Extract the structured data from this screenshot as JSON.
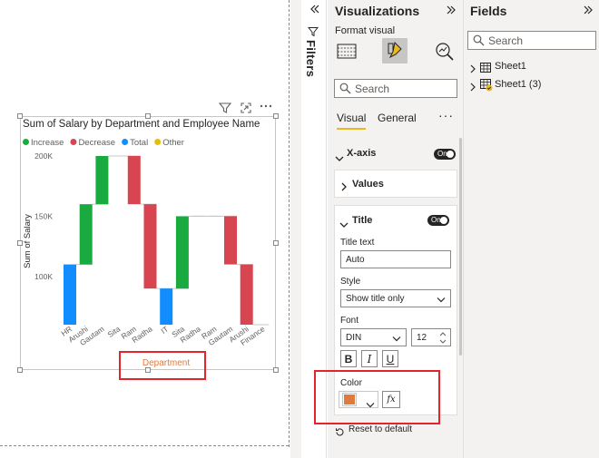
{
  "filters": {
    "title": "Filters",
    "collapse_icon": "double-chevron-left"
  },
  "visualizations": {
    "title": "Visualizations",
    "subtitle": "Format visual",
    "search_placeholder": "Search",
    "tabs": [
      {
        "label": "Visual",
        "active": true
      },
      {
        "label": "General",
        "active": false
      }
    ],
    "more_label": "···",
    "sections": {
      "x_axis": {
        "label": "X-axis",
        "toggle": "On"
      },
      "values": {
        "label": "Values"
      },
      "title": {
        "label": "Title",
        "toggle": "On",
        "title_text_label": "Title text",
        "title_text_value": "Auto",
        "style_label": "Style",
        "style_value": "Show title only",
        "font_label": "Font",
        "font_family_value": "DIN",
        "font_size_value": "12",
        "bold_label": "B",
        "italic_label": "I",
        "underline_label": "U",
        "color_label": "Color",
        "color_value": "#e07a3d",
        "fx_label": "fx"
      }
    },
    "reset_label": "Reset to default"
  },
  "fields": {
    "title": "Fields",
    "search_placeholder": "Search",
    "tables": [
      {
        "name": "Sheet1"
      },
      {
        "name": "Sheet1 (3)"
      }
    ]
  },
  "visual": {
    "title": "Sum of Salary by Department and Employee Name",
    "legend": [
      {
        "label": "Increase",
        "color": "#1aab40"
      },
      {
        "label": "Decrease",
        "color": "#d64550"
      },
      {
        "label": "Total",
        "color": "#118dff"
      },
      {
        "label": "Other",
        "color": "#e6c000"
      }
    ],
    "y_axis_label": "Sum of Salary",
    "x_axis_title": "Department",
    "x_axis_title_color": "#e07a3d"
  },
  "chart_data": {
    "type": "bar",
    "subtype": "waterfall",
    "title": "Sum of Salary by Department and Employee Name",
    "xlabel": "Department",
    "ylabel": "Sum of Salary",
    "y_ticks": [
      "100K",
      "150K",
      "200K"
    ],
    "y_tick_values": [
      100000,
      150000,
      200000
    ],
    "ylim": [
      60000,
      200000
    ],
    "grid": false,
    "legend_position": "top-left",
    "categories": [
      "HR",
      "Arushi",
      "Gautam",
      "Sita",
      "Ram",
      "Radha",
      "IT",
      "Sita",
      "Radha",
      "Ram",
      "Gautam",
      "Arushi",
      "Finance"
    ],
    "bars": [
      {
        "category": "HR",
        "kind": "Total",
        "start": 60000,
        "end": 110000
      },
      {
        "category": "Arushi",
        "kind": "Increase",
        "start": 110000,
        "end": 160000
      },
      {
        "category": "Gautam",
        "kind": "Increase",
        "start": 160000,
        "end": 200000
      },
      {
        "category": "Sita",
        "kind": "Other",
        "start": 200000,
        "end": 200000
      },
      {
        "category": "Ram",
        "kind": "Decrease",
        "start": 200000,
        "end": 160000
      },
      {
        "category": "Radha",
        "kind": "Decrease",
        "start": 160000,
        "end": 90000
      },
      {
        "category": "IT",
        "kind": "Total",
        "start": 60000,
        "end": 90000
      },
      {
        "category": "Sita",
        "kind": "Increase",
        "start": 90000,
        "end": 150000
      },
      {
        "category": "Radha",
        "kind": "Other",
        "start": 150000,
        "end": 150000
      },
      {
        "category": "Ram",
        "kind": "Other",
        "start": 150000,
        "end": 150000
      },
      {
        "category": "Gautam",
        "kind": "Decrease",
        "start": 150000,
        "end": 110000
      },
      {
        "category": "Arushi",
        "kind": "Decrease",
        "start": 110000,
        "end": 60000
      },
      {
        "category": "Finance",
        "kind": "Total",
        "start": 60000,
        "end": 60000
      }
    ],
    "colors": {
      "Increase": "#1aab40",
      "Decrease": "#d64550",
      "Total": "#118dff",
      "Other": "#e6c000"
    }
  }
}
